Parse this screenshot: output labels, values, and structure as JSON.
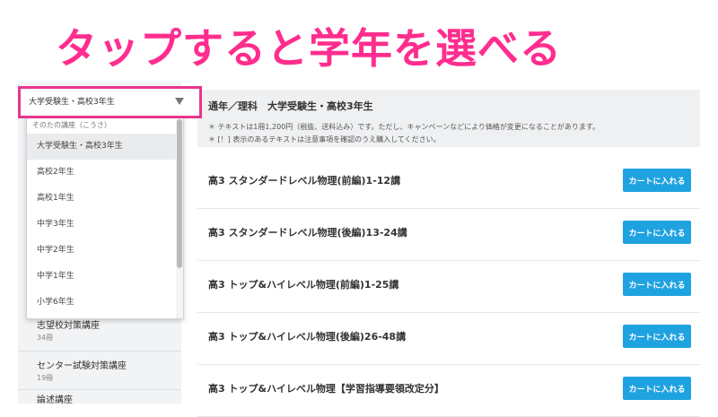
{
  "headline": "タップすると学年を選べる",
  "grade_select": {
    "selected": "大学受験生・高校3年生",
    "partial_label": "そのたの講座（こうさ）",
    "options": [
      "大学受験生・高校3年生",
      "高校2年生",
      "高校1年生",
      "中学3年生",
      "中学2年生",
      "中学1年生",
      "小学6年生"
    ]
  },
  "sidebar": {
    "items": [
      {
        "name": "志望校対策講座",
        "count": "34冊"
      },
      {
        "name": "センター試験対策講座",
        "count": "19冊"
      },
      {
        "name": "論述講座"
      }
    ]
  },
  "info": {
    "title": "通年／理科　大学受験生・高校3年生",
    "notes": [
      "＊ テキストは1冊1,200円（税抜、送料込み）です。ただし、キャンペーンなどにより価格が変更になることがあります。",
      "＊ [！] 表示のあるテキストは注意事項を確認のうえ購入してください。"
    ]
  },
  "products": [
    {
      "title": "高3 スタンダードレベル物理(前編)1-12講",
      "button": "カートに入れる"
    },
    {
      "title": "高3 スタンダードレベル物理(後編)13-24講",
      "button": "カートに入れる"
    },
    {
      "title": "高3 トップ&ハイレベル物理(前編)1-25講",
      "button": "カートに入れる"
    },
    {
      "title": "高3 トップ&ハイレベル物理(後編)26-48講",
      "button": "カートに入れる"
    },
    {
      "title": "高3 トップ&ハイレベル物理【学習指導要領改定分】",
      "button": "カートに入れる"
    }
  ]
}
